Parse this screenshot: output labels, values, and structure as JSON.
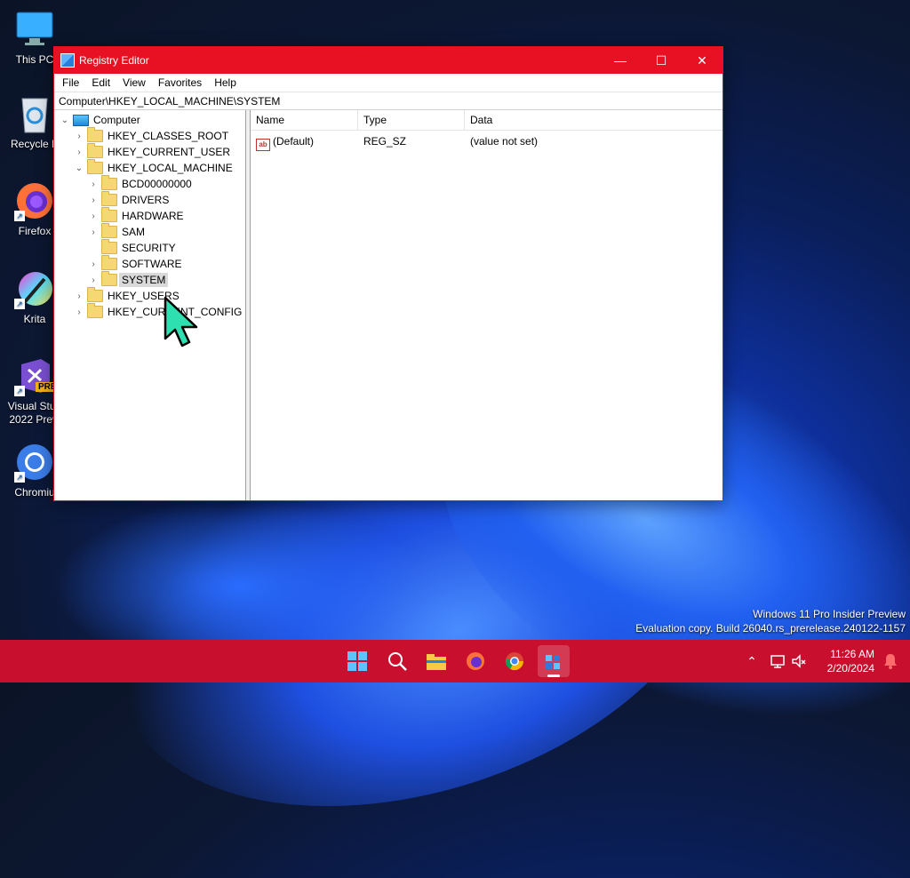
{
  "desktop": {
    "icons": [
      {
        "label": "This PC"
      },
      {
        "label": "Recycle B"
      },
      {
        "label": "Firefox"
      },
      {
        "label": "Krita"
      },
      {
        "label": "Visual Stud\n2022 Previ"
      },
      {
        "label": "Chromiu"
      }
    ],
    "pre_badge": "PRE"
  },
  "window": {
    "title": "Registry Editor",
    "controls": {
      "minimize": "—",
      "maximize": "☐",
      "close": "✕"
    },
    "menu": [
      "File",
      "Edit",
      "View",
      "Favorites",
      "Help"
    ],
    "address": "Computer\\HKEY_LOCAL_MACHINE\\SYSTEM",
    "tree": [
      {
        "label": "Computer",
        "level": 0,
        "expanded": true
      },
      {
        "label": "HKEY_CLASSES_ROOT",
        "level": 1
      },
      {
        "label": "HKEY_CURRENT_USER",
        "level": 1
      },
      {
        "label": "HKEY_LOCAL_MACHINE",
        "level": 1,
        "expanded": true
      },
      {
        "label": "BCD00000000",
        "level": 2
      },
      {
        "label": "DRIVERS",
        "level": 2
      },
      {
        "label": "HARDWARE",
        "level": 2
      },
      {
        "label": "SAM",
        "level": 2
      },
      {
        "label": "SECURITY",
        "level": 2
      },
      {
        "label": "SOFTWARE",
        "level": 2
      },
      {
        "label": "SYSTEM",
        "level": 2,
        "selected": true
      },
      {
        "label": "HKEY_USERS",
        "level": 1
      },
      {
        "label": "HKEY_CURRENT_CONFIG",
        "level": 1
      }
    ],
    "columns": {
      "name": "Name",
      "type": "Type",
      "data": "Data"
    },
    "values": [
      {
        "icon": "ab",
        "name": "(Default)",
        "type": "REG_SZ",
        "data": "(value not set)"
      }
    ]
  },
  "watermark": {
    "line1": "Windows 11 Pro Insider Preview",
    "line2": "Evaluation copy. Build 26040.rs_prerelease.240122-1157"
  },
  "taskbar": {
    "time": "11:26 AM",
    "date": "2/20/2024",
    "accent": "#c8102e",
    "apps": [
      "start",
      "search",
      "file-explorer",
      "firefox",
      "chrome",
      "registry-editor"
    ]
  },
  "colors": {
    "titlebar": "#e81123",
    "selection": "#d9d9d9"
  }
}
